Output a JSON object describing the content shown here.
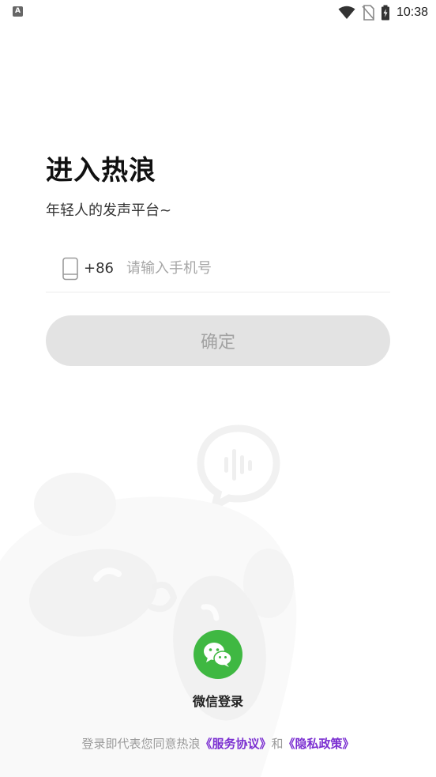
{
  "status_bar": {
    "time": "10:38",
    "app_icon_letter": "A",
    "icons": [
      "wifi-icon",
      "no-sim-icon",
      "battery-charging-icon"
    ]
  },
  "login": {
    "title": "进入热浪",
    "subtitle": "年轻人的发声平台~",
    "country_code": "+86",
    "phone_placeholder": "请输入手机号",
    "phone_value": "",
    "confirm_label": "确定"
  },
  "wechat": {
    "label": "微信登录",
    "icon": "wechat-icon",
    "color": "#3fb842"
  },
  "agreement": {
    "prefix": "登录即代表您同意热浪",
    "service_link": "《服务协议》",
    "conjunction": "和",
    "privacy_link": "《隐私政策》",
    "link_color": "#7b2fd1"
  }
}
